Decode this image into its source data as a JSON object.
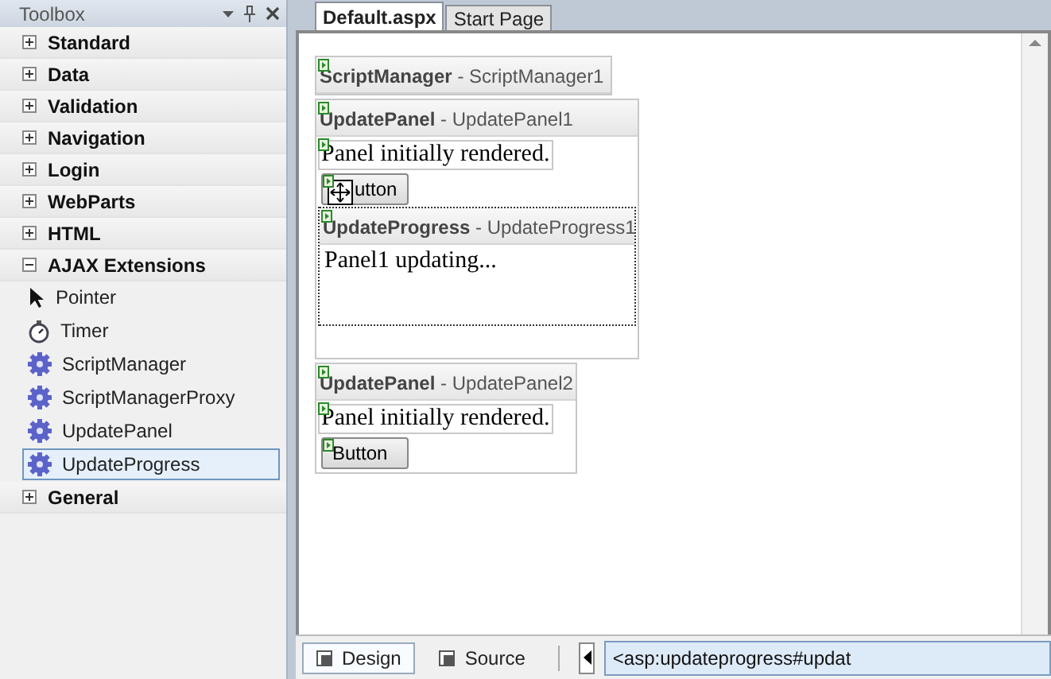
{
  "toolbox": {
    "title": "Toolbox",
    "groups": [
      {
        "label": "Standard",
        "expanded": false
      },
      {
        "label": "Data",
        "expanded": false
      },
      {
        "label": "Validation",
        "expanded": false
      },
      {
        "label": "Navigation",
        "expanded": false
      },
      {
        "label": "Login",
        "expanded": false
      },
      {
        "label": "WebParts",
        "expanded": false
      },
      {
        "label": "HTML",
        "expanded": false
      },
      {
        "label": "AJAX Extensions",
        "expanded": true,
        "items": [
          {
            "label": "Pointer",
            "kind": "pointer",
            "selected": false
          },
          {
            "label": "Timer",
            "kind": "timer",
            "selected": false
          },
          {
            "label": "ScriptManager",
            "kind": "gear",
            "selected": false
          },
          {
            "label": "ScriptManagerProxy",
            "kind": "gear",
            "selected": false
          },
          {
            "label": "UpdatePanel",
            "kind": "gear",
            "selected": false
          },
          {
            "label": "UpdateProgress",
            "kind": "gear",
            "selected": true
          }
        ]
      },
      {
        "label": "General",
        "expanded": false
      }
    ]
  },
  "tabs": [
    {
      "label": "Default.aspx",
      "selected": true
    },
    {
      "label": "Start Page",
      "selected": false
    }
  ],
  "designer": {
    "controls": [
      {
        "kind": "script_manager",
        "label": "**ScriptManager** - ScriptManager1"
      },
      {
        "kind": "update_panel",
        "label": "**UpdatePanel** - UpdatePanel1",
        "text": "Panel initially rendered.",
        "button": "utton",
        "progress": {
          "label": "**UpdateProgress** - UpdateProgress1",
          "text": "Panel1 updating..."
        }
      },
      {
        "kind": "update_panel",
        "label": "**UpdatePanel** - UpdatePanel2",
        "text": "Panel initially rendered.",
        "button": "Button"
      }
    ]
  },
  "view_tabs": [
    {
      "label": "Design",
      "selected": true
    },
    {
      "label": "Source",
      "selected": false
    }
  ],
  "breadcrumb": "<asp:updateprogress#updat"
}
